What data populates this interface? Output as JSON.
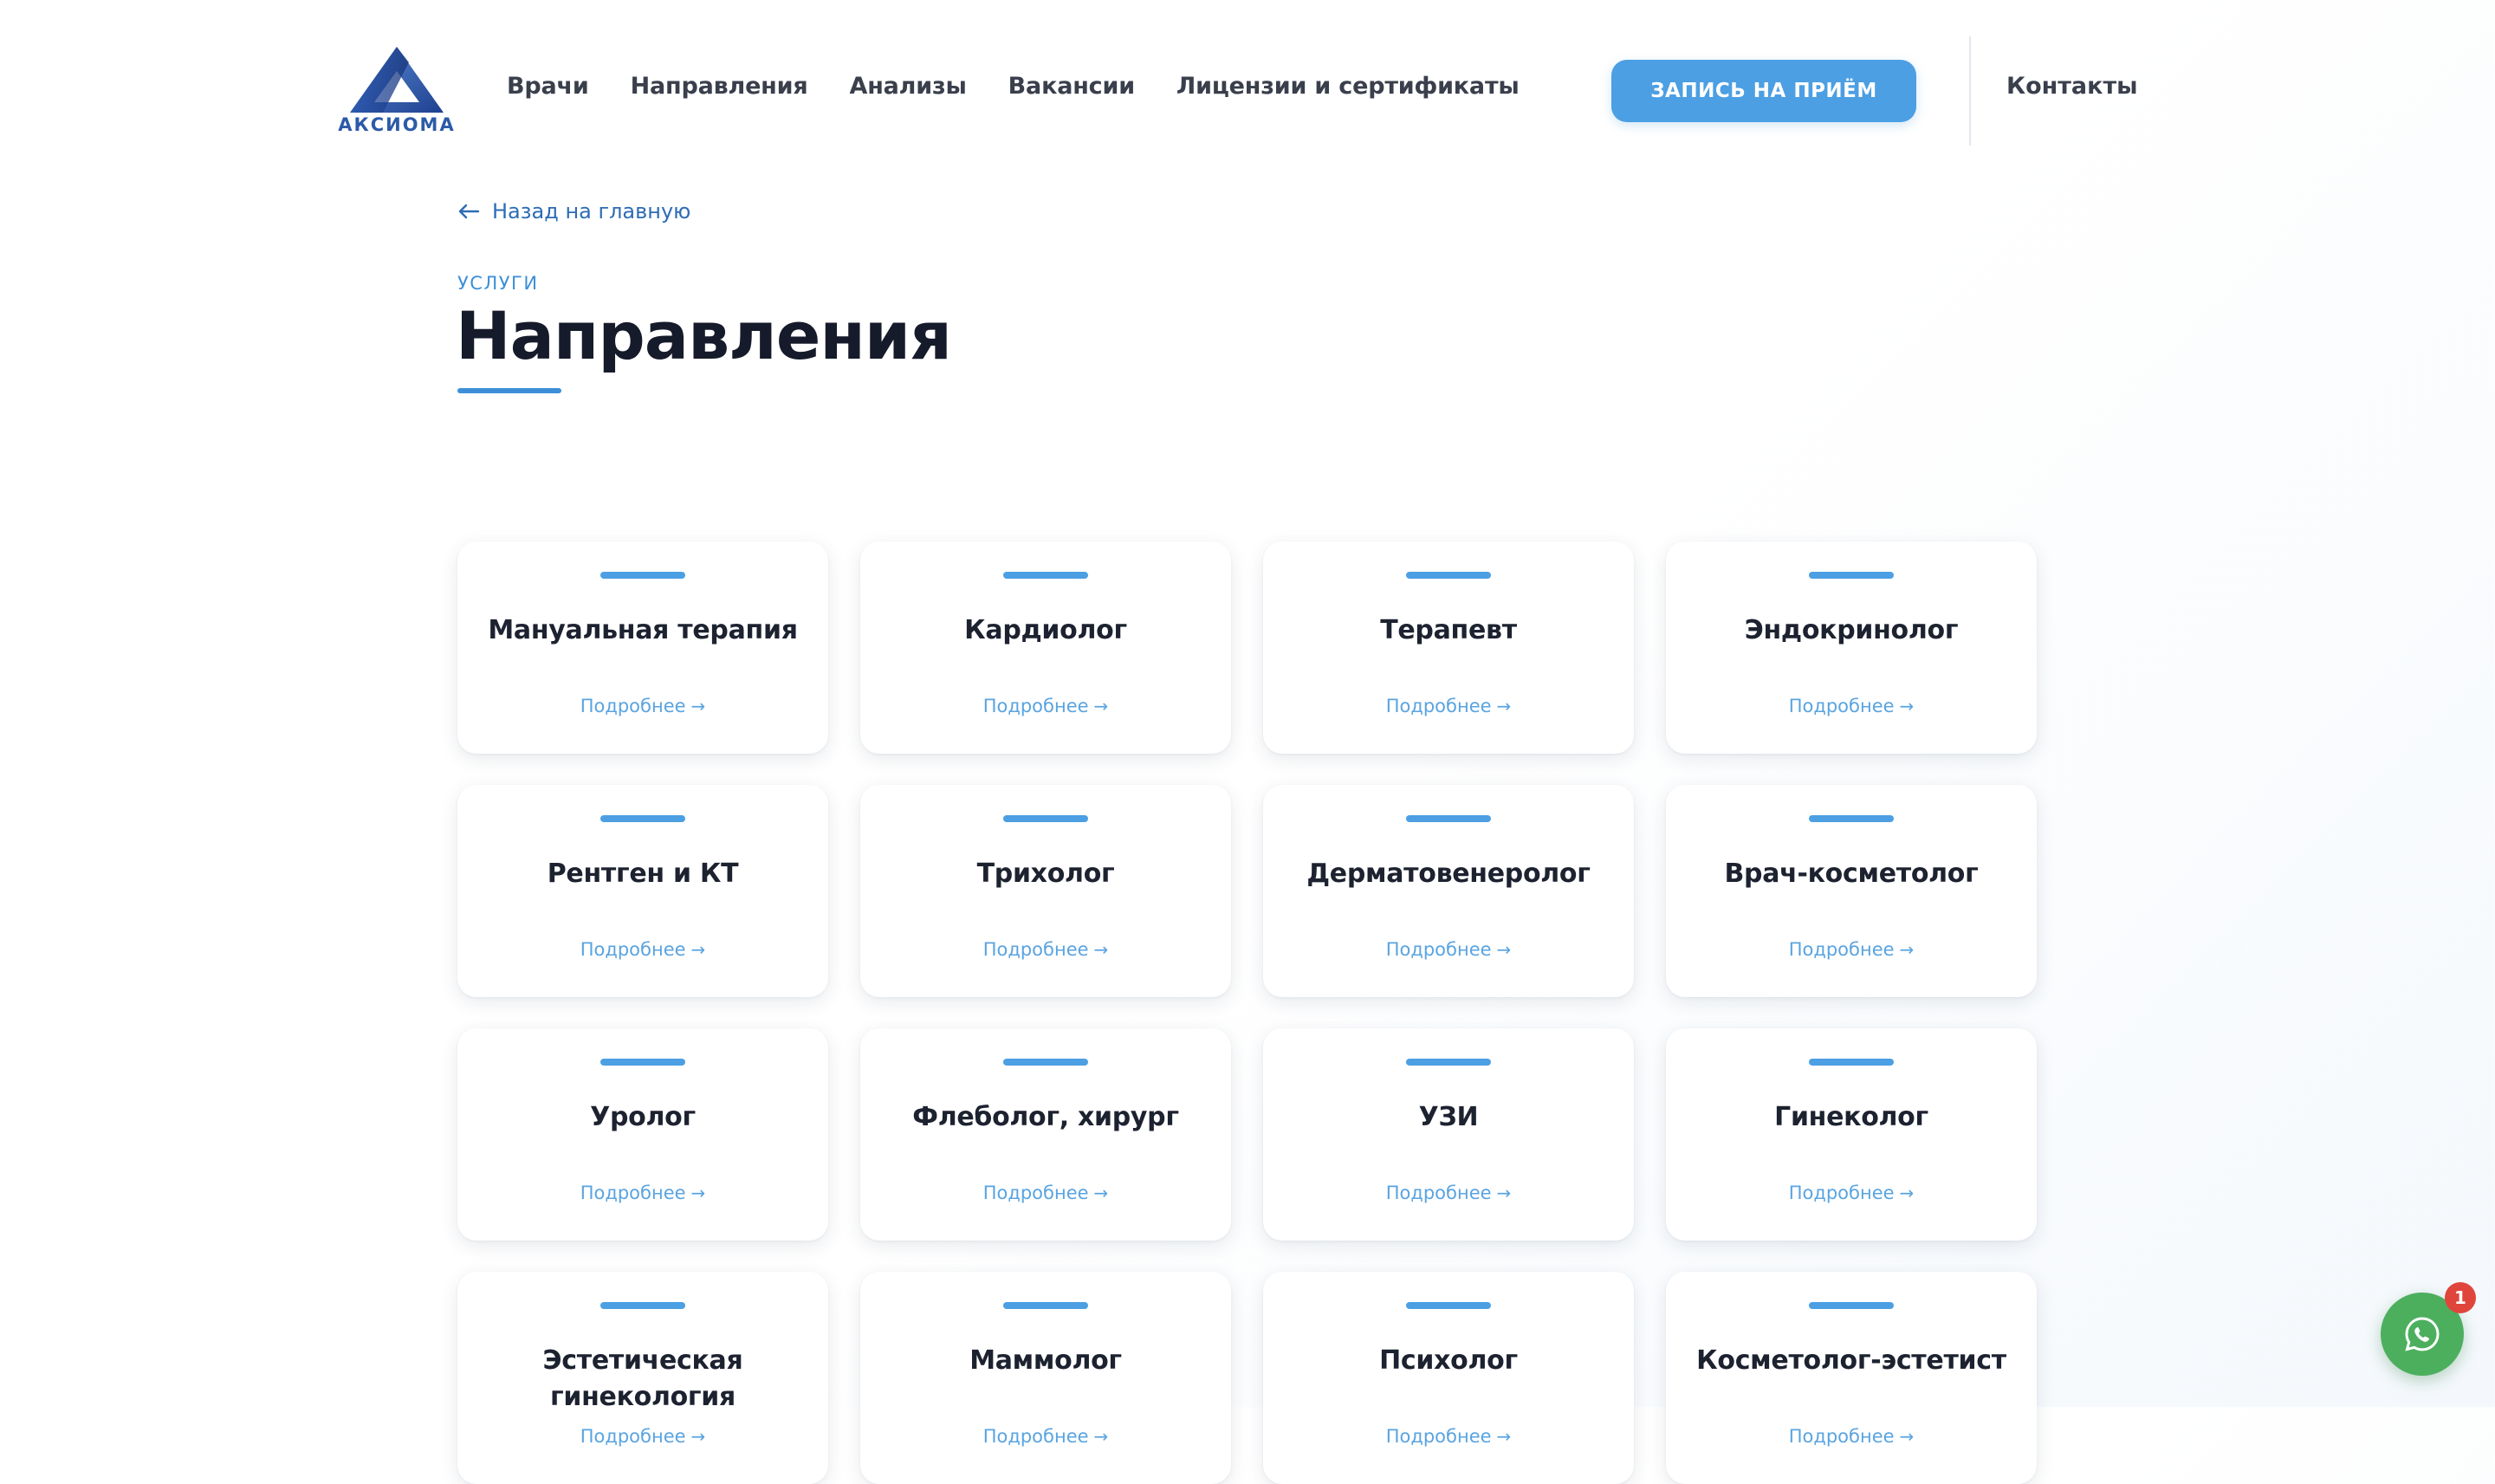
{
  "header": {
    "logo_text": "АКСИОМА",
    "nav": [
      {
        "label": "Врачи"
      },
      {
        "label": "Направления"
      },
      {
        "label": "Анализы"
      },
      {
        "label": "Вакансии"
      },
      {
        "label": "Лицензии и сертификаты"
      }
    ],
    "cta_label": "ЗАПИСЬ НА ПРИЁМ",
    "contacts_label": "Контакты"
  },
  "page": {
    "back_label": "Назад на главную",
    "eyebrow": "УСЛУГИ",
    "title": "Направления"
  },
  "cards": [
    {
      "title": "Мануальная терапия",
      "more": "Подробнее"
    },
    {
      "title": "Кардиолог",
      "more": "Подробнее"
    },
    {
      "title": "Терапевт",
      "more": "Подробнее"
    },
    {
      "title": "Эндокринолог",
      "more": "Подробнее"
    },
    {
      "title": "Рентген и КТ",
      "more": "Подробнее"
    },
    {
      "title": "Трихолог",
      "more": "Подробнее"
    },
    {
      "title": "Дерматовенеролог",
      "more": "Подробнее"
    },
    {
      "title": "Врач-косметолог",
      "more": "Подробнее"
    },
    {
      "title": "Уролог",
      "more": "Подробнее"
    },
    {
      "title": "Флеболог, хирург",
      "more": "Подробнее"
    },
    {
      "title": "УЗИ",
      "more": "Подробнее"
    },
    {
      "title": "Гинеколог",
      "more": "Подробнее"
    },
    {
      "title": "Эстетическая гинекология",
      "more": "Подробнее"
    },
    {
      "title": "Маммолог",
      "more": "Подробнее"
    },
    {
      "title": "Психолог",
      "more": "Подробнее"
    },
    {
      "title": "Косметолог-эстетист",
      "more": "Подробнее"
    }
  ],
  "chat": {
    "icon": "whatsapp-icon",
    "badge_count": "1"
  },
  "colors": {
    "accent": "#4c9fe3",
    "link": "#2d6cb5",
    "chat": "#4caf5e",
    "badge": "#e0453c"
  }
}
